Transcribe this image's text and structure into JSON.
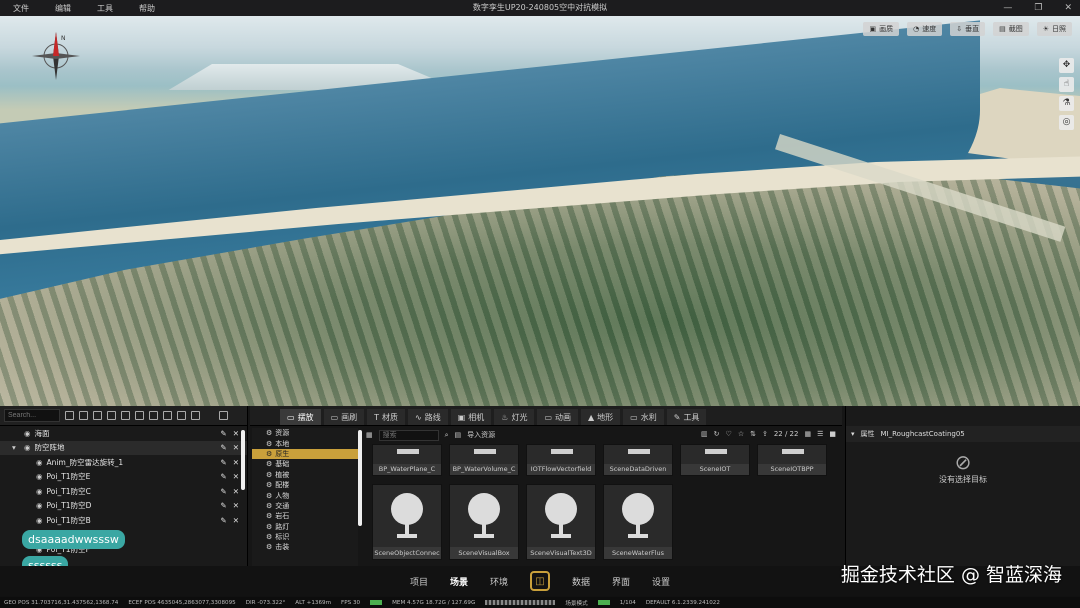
{
  "menu": [
    "文件",
    "编辑",
    "工具",
    "帮助"
  ],
  "window_title": "数字孪生UP20-240805空中对抗模拟",
  "window_controls": [
    "—",
    "❐",
    "✕"
  ],
  "view_buttons": [
    "画质",
    "速度",
    "垂直",
    "截图",
    "日照"
  ],
  "side_tools": [
    "✥",
    "☝",
    "⚗",
    "◎"
  ],
  "compass_label": "N",
  "outliner": {
    "search_placeholder": "Search...",
    "rows": [
      {
        "label": "海面",
        "indent": 0
      },
      {
        "label": "防空阵地",
        "indent": 0
      },
      {
        "label": "Anim_防空雷达旋转_1",
        "indent": 2
      },
      {
        "label": "Poi_T1防空E",
        "indent": 2
      },
      {
        "label": "Poi_T1防空C",
        "indent": 2
      },
      {
        "label": "Poi_T1防空D",
        "indent": 2
      },
      {
        "label": "Poi_T1防空B",
        "indent": 2
      },
      {
        "label": "",
        "indent": 2
      },
      {
        "label": "Poi_T1防空F",
        "indent": 2
      }
    ],
    "tooltip1": "dsaaaadwwsssw",
    "tooltip2": "ssssss"
  },
  "content_tabs": [
    "摆放",
    "画刷",
    "材质",
    "路线",
    "相机",
    "灯光",
    "动画",
    "地形",
    "水利",
    "工具"
  ],
  "tree": [
    "资源",
    "本地",
    "原生",
    "基础",
    "植被",
    "配楼",
    "人物",
    "交通",
    "岩石",
    "路灯",
    "标识",
    "击装"
  ],
  "assets": {
    "search_placeholder": "搜索",
    "import_label": "导入资源",
    "page": "22 / 22",
    "top_row": [
      "BP_WaterPlane_C",
      "BP_WaterVolume_C",
      "IOTFlowVectorfield",
      "SceneDataDriven",
      "SceneIOT",
      "SceneIOTBPP"
    ],
    "cards": [
      "SceneObjectConnec",
      "SceneVisualBox",
      "SceneVisualText3D",
      "SceneWaterFlus"
    ]
  },
  "props": {
    "title": "属性",
    "asset": "MI_RoughcastCoating05",
    "empty": "没有选择目标"
  },
  "nav": [
    "项目",
    "场景",
    "环境",
    "数据",
    "界面",
    "设置"
  ],
  "nav_active": "场景",
  "watermark": "掘金技术社区 @ 智蓝深海",
  "status": {
    "geo": "GEO POS   31.703716,31.437562,1368.74",
    "ecef": "ECEF POS   4635045,2863077,3308095",
    "dir": "DIR   -073.322°",
    "alt": "ALT   +1369m",
    "fps": "FPS   30",
    "mem": "MEM   4.57G   18.72G / 127.69G",
    "mode": "场景模式",
    "frames": "1/104",
    "default": "DEFAULT   6.1.2339.241022"
  }
}
